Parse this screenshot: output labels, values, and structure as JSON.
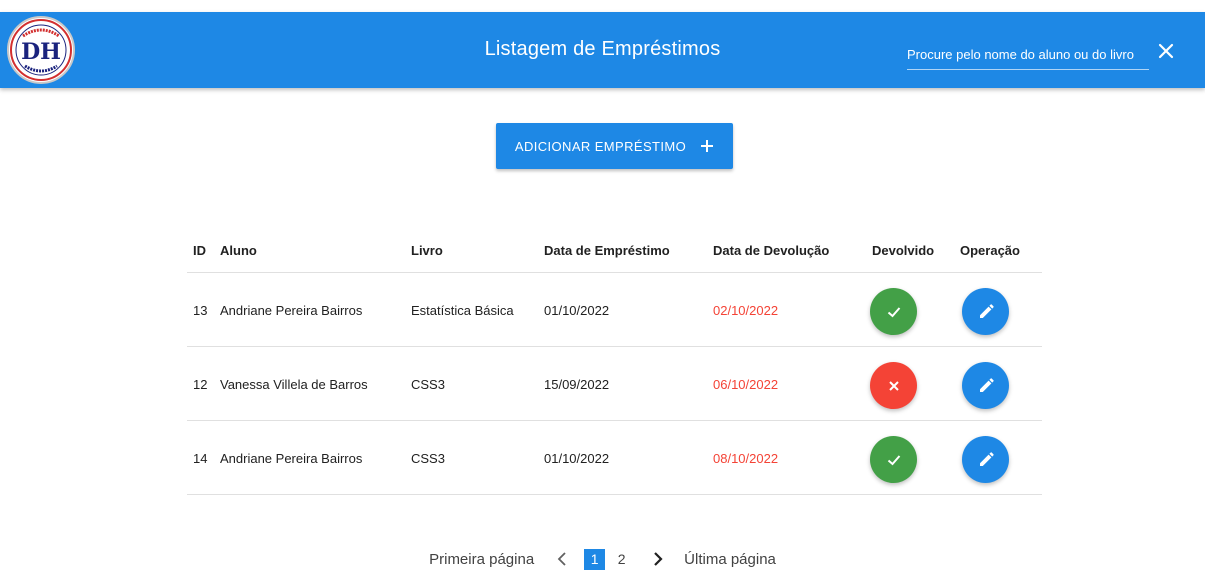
{
  "header": {
    "title": "Listagem de Empréstimos",
    "search_placeholder": "Procure pelo nome do aluno ou do livro",
    "logo_text": "DH",
    "color": "#1e88e5"
  },
  "add_button": {
    "label": "ADICIONAR EMPRÉSTIMO",
    "icon": "plus-icon"
  },
  "table": {
    "columns": [
      "ID",
      "Aluno",
      "Livro",
      "Data de Empréstimo",
      "Data de Devolução",
      "Devolvido",
      "Operação"
    ],
    "rows": [
      {
        "id": "13",
        "aluno": "Andriane Pereira Bairros",
        "livro": "Estatística Básica",
        "data_emprestimo": "01/10/2022",
        "data_devolucao": "02/10/2022",
        "devolvido": true
      },
      {
        "id": "12",
        "aluno": "Vanessa Villela de Barros",
        "livro": "CSS3",
        "data_emprestimo": "15/09/2022",
        "data_devolucao": "06/10/2022",
        "devolvido": false
      },
      {
        "id": "14",
        "aluno": "Andriane Pereira Bairros",
        "livro": "CSS3",
        "data_emprestimo": "01/10/2022",
        "data_devolucao": "08/10/2022",
        "devolvido": true
      }
    ]
  },
  "pagination": {
    "first_label": "Primeira página",
    "last_label": "Última página",
    "pages": [
      "1",
      "2"
    ],
    "current": "1"
  },
  "colors": {
    "primary": "#1e88e5",
    "success": "#43a047",
    "danger": "#f44336"
  }
}
